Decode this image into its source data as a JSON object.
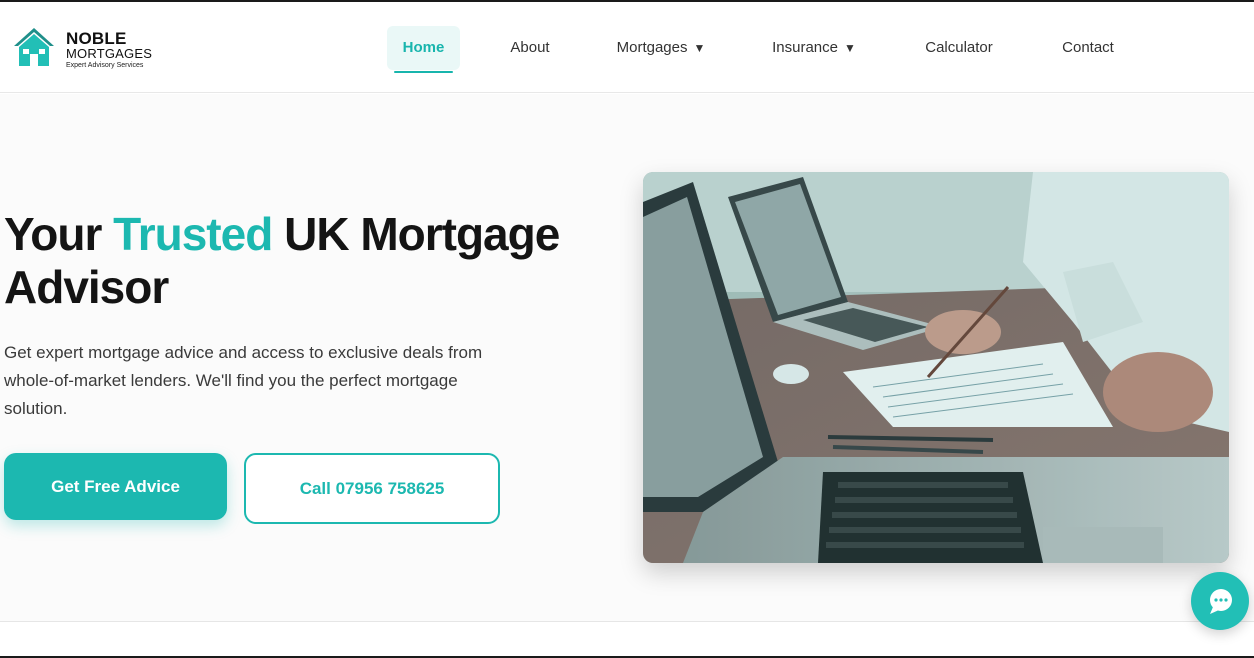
{
  "brand": {
    "name": "NOBLE",
    "sub": "MORTGAGES",
    "tagline": "Expert Advisory Services",
    "accent_color": "#1cb8b0"
  },
  "nav": {
    "home": "Home",
    "about": "About",
    "mortgages": "Mortgages",
    "insurance": "Insurance",
    "calculator": "Calculator",
    "contact": "Contact",
    "caret": "▼"
  },
  "hero": {
    "title_pre": "Your ",
    "title_accent": "Trusted",
    "title_post": " UK Mortgage Advisor",
    "lead": "Get expert mortgage advice and access to exclusive deals from whole-of-market lenders. We'll find you the perfect mortgage solution.",
    "cta_primary": "Get Free Advice",
    "cta_secondary": "Call 07956 758625"
  },
  "icons": {
    "logo": "house-icon",
    "chat": "chat-bubble-icon",
    "dropdown": "chevron-down-icon"
  }
}
